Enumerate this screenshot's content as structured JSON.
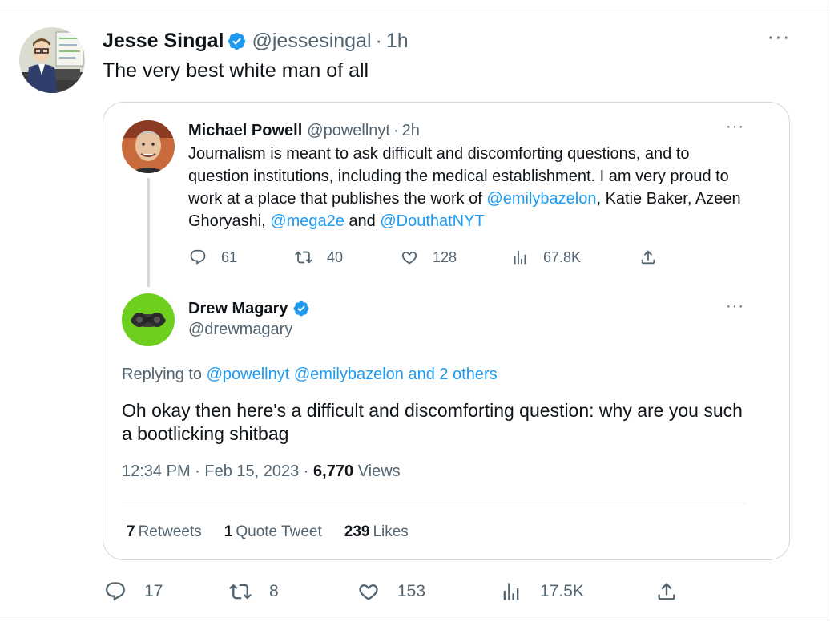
{
  "main_tweet": {
    "author_name": "Jesse Singal",
    "handle": "@jessesingal",
    "separator": "·",
    "time": "1h",
    "text": "The very best white man of all",
    "more": "···",
    "actions": {
      "replies": "17",
      "retweets": "8",
      "likes": "153",
      "views": "17.5K"
    }
  },
  "quoted_tweet": {
    "author_name": "Michael Powell",
    "handle": "@powellnyt",
    "separator": "·",
    "time": "2h",
    "more": "···",
    "text_parts": {
      "t1": "Journalism is meant to ask difficult and discomforting questions, and to question institutions, including the medical establishment. I am very proud to work at a place that publishes the work of ",
      "m1": "@emilybazelon",
      "t2": ", Katie Baker, Azeen Ghoryashi, ",
      "m2": "@mega2e",
      "t3": " and ",
      "m3": "@DouthatNYT"
    },
    "actions": {
      "replies": "61",
      "retweets": "40",
      "likes": "128",
      "views": "67.8K"
    }
  },
  "reply_tweet": {
    "author_name": "Drew Magary",
    "handle": "@drewmagary",
    "more": "···",
    "replying_prefix": "Replying to ",
    "replying_links": "@powellnyt @emilybazelon and 2 others",
    "text": "Oh okay then here's a difficult and discomforting question: why are you such a bootlicking shitbag",
    "timestamp": "12:34 PM · Feb 15, 2023 · ",
    "views_count": "6,770",
    "views_label": " Views",
    "stats": {
      "retweets_count": "7",
      "retweets_label": "Retweets",
      "quotes_count": "1",
      "quotes_label": "Quote Tweet",
      "likes_count": "239",
      "likes_label": "Likes"
    }
  },
  "colors": {
    "accent": "#1d9bf0",
    "text": "#0f1419",
    "secondary": "#536471",
    "border": "#cfd9de"
  }
}
